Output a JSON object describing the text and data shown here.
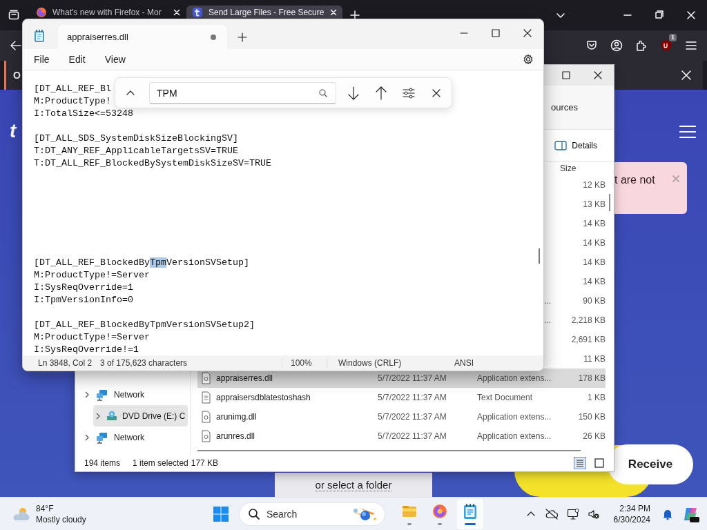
{
  "browser": {
    "tabs": [
      {
        "title": "What's new with Firefox - Mor",
        "selected": false
      },
      {
        "title": "Send Large Files - Free Secure",
        "selected": true
      }
    ],
    "badge": "1",
    "notification": {
      "text": "O"
    },
    "page": {
      "logo": "t",
      "alert": "t are not",
      "receive": "Receive",
      "folder_link": "or select a folder"
    }
  },
  "explorer": {
    "address": "ources",
    "details_button": "Details",
    "size_header": "Size",
    "rows": [
      {
        "size": "12 KB",
        "selected": false
      },
      {
        "size": "13 KB",
        "selected": false
      },
      {
        "size": "14 KB",
        "selected": false
      },
      {
        "size": "14 KB",
        "selected": false
      },
      {
        "size": "14 KB",
        "selected": false
      },
      {
        "size": "14 KB",
        "selected": false
      },
      {
        "type": "...",
        "size": "90 KB",
        "selected": false
      },
      {
        "type": "...",
        "size": "2,218 KB",
        "selected": false
      },
      {
        "size": "2,691 KB",
        "selected": false
      },
      {
        "size": "11 KB",
        "selected": false
      },
      {
        "kind": "application",
        "name": "appraiserres.dll",
        "date": "5/7/2022 11:37 AM",
        "type": "Application extens...",
        "size": "178 KB",
        "selected": true
      },
      {
        "kind": "document",
        "name": "appraisersdblatestoshash",
        "date": "5/7/2022 11:37 AM",
        "type": "Text Document",
        "size": "1 KB",
        "selected": false
      },
      {
        "kind": "application",
        "name": "arunimg.dll",
        "date": "5/7/2022 11:37 AM",
        "type": "Application extens...",
        "size": "150 KB",
        "selected": false
      },
      {
        "kind": "application",
        "name": "arunres.dll",
        "date": "5/7/2022 11:37 AM",
        "type": "Application extens...",
        "size": "26 KB",
        "selected": false
      }
    ],
    "nav": [
      {
        "label": "Network",
        "selected": false
      },
      {
        "label": "DVD Drive (E:) C",
        "selected": true
      },
      {
        "label": "Network",
        "selected": false
      }
    ],
    "status": {
      "count": "194 items",
      "selection": "1 item selected",
      "selection_size": "177 KB"
    }
  },
  "notepad": {
    "tab": {
      "title": "appraiserres.dll",
      "modified": true
    },
    "menu": [
      "File",
      "Edit",
      "View"
    ],
    "find": {
      "value": "TPM"
    },
    "blocks": [
      {
        "lines": [
          [
            {
              "text": "[DT_ALL_REF_Bl",
              "match": false
            }
          ],
          [
            {
              "text": "M:ProductType!",
              "match": false
            }
          ],
          [
            {
              "text": "I:TotalSize<=53248",
              "match": false
            }
          ]
        ]
      },
      {
        "lines": [
          [
            {
              "text": "[DT_ALL_SDS_SystemDiskSizeBlockingSV]",
              "match": false
            }
          ],
          [
            {
              "text": "T:DT_ANY_REF_ApplicableTargetsSV=TRUE",
              "match": false
            }
          ],
          [
            {
              "text": "T:DT_ALL_REF_BlockedBySystemDiskSizeSV=TRUE",
              "match": false
            }
          ]
        ]
      },
      {
        "lines": [
          [
            {
              "text": "[DT_ALL_REF_BlockedBy",
              "match": false
            },
            {
              "text": "Tpm",
              "match": true
            },
            {
              "text": "VersionSVSetup]",
              "match": false
            }
          ],
          [
            {
              "text": "M:ProductType!=Server",
              "match": false
            }
          ],
          [
            {
              "text": "I:SysReqOverride=1",
              "match": false
            }
          ],
          [
            {
              "text": "I:TpmVersionInfo=0",
              "match": false
            }
          ]
        ]
      },
      {
        "lines": [
          [
            {
              "text": "[DT_ALL_REF_BlockedByTpmVersionSVSetup2]",
              "match": false
            }
          ],
          [
            {
              "text": "M:ProductType!=Server",
              "match": false
            }
          ],
          [
            {
              "text": "I:SysReqOverride!=1",
              "match": false
            }
          ]
        ]
      }
    ],
    "status": [
      "Ln 3848, Col 2",
      "3 of 175,623 characters",
      "100%",
      "Windows (CRLF)",
      "ANSI"
    ]
  },
  "taskbar": {
    "temperature": "84°F",
    "condition": "Mostly cloudy",
    "search": "Search",
    "apps": [
      {
        "kind": "explorer",
        "active": false
      },
      {
        "kind": "firefox",
        "active": false
      },
      {
        "kind": "notepad",
        "active": true
      }
    ],
    "time": "2:34 PM",
    "date": "6/30/2024"
  }
}
